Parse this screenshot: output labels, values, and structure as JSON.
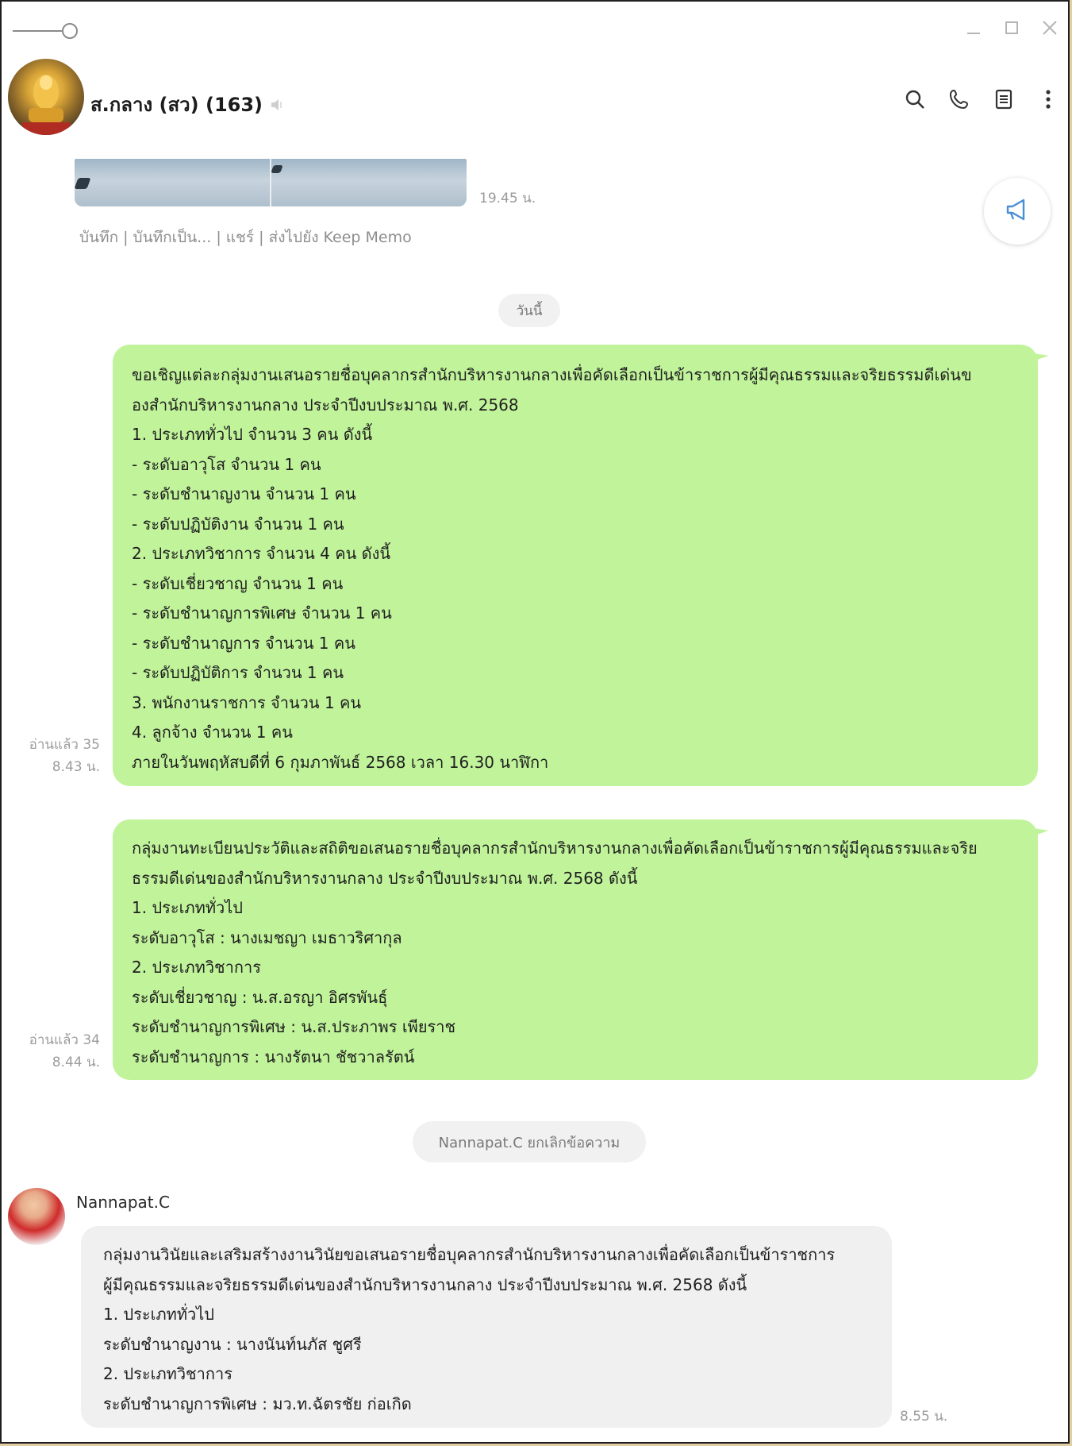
{
  "window": {
    "controls": {
      "minimize": "—",
      "maximize": "□",
      "close": "✕"
    }
  },
  "header": {
    "group_name": "ส.กลาง (สว) (163)",
    "icons": [
      "search-icon",
      "phone-icon",
      "notes-icon",
      "more-icon"
    ]
  },
  "previous_media": {
    "time": "19.45 น.",
    "actions": "บันทึก | บันทึกเป็น... | แชร์ | ส่งไปยัง Keep Memo"
  },
  "date_separator": "วันนี้",
  "messages": [
    {
      "read": "อ่านแล้ว 35",
      "time": "8.43 น.",
      "lines": [
        "ขอเชิญแต่ละกลุ่มงานเสนอรายชื่อบุคลากรสำนักบริหารงานกลางเพื่อคัดเลือกเป็นข้าราชการผู้มีคุณธรรมและจริยธรรมดีเด่นข",
        "องสำนักบริหารงานกลาง ประจำปีงบประมาณ พ.ศ. 2568",
        "1. ประเภททั่วไป จำนวน 3 คน ดังนี้",
        "- ระดับอาวุโส จำนวน 1 คน",
        "- ระดับชำนาญงาน จำนวน 1 คน",
        "- ระดับปฏิบัติงาน จำนวน 1 คน",
        "2. ประเภทวิชาการ จำนวน 4 คน ดังนี้",
        "- ระดับเชี่ยวชาญ จำนวน 1 คน",
        "- ระดับชำนาญการพิเศษ จำนวน 1 คน",
        "- ระดับชำนาญการ จำนวน 1 คน",
        "- ระดับปฏิบัติการ จำนวน 1 คน",
        "3. พนักงานราชการ จำนวน 1 คน",
        "4. ลูกจ้าง จำนวน 1 คน",
        "ภายในวันพฤหัสบดีที่ 6 กุมภาพันธ์ 2568 เวลา 16.30 นาฬิกา"
      ]
    },
    {
      "read": "อ่านแล้ว 34",
      "time": "8.44 น.",
      "lines": [
        "กลุ่มงานทะเบียนประวัติและสถิติขอเสนอรายชื่อบุคลากรสำนักบริหารงานกลางเพื่อคัดเลือกเป็นข้าราชการผู้มีคุณธรรมและจริย",
        "ธรรมดีเด่นของสำนักบริหารงานกลาง ประจำปีงบประมาณ พ.ศ. 2568 ดังนี้",
        "1. ประเภททั่วไป",
        "ระดับอาวุโส : นางเมชญา เมธาวริศากุล",
        "2. ประเภทวิชาการ",
        "ระดับเชี่ยวชาญ : น.ส.อรญา อิศรพันธุ์",
        "ระดับชำนาญการพิเศษ : น.ส.ประภาพร เพียราช",
        "ระดับชำนาญการ : นางรัตนา ชัชวาลรัตน์"
      ]
    }
  ],
  "system_notice": "Nannapat.C ยกเลิกข้อความ",
  "incoming": {
    "sender": "Nannapat.C",
    "time": "8.55 น.",
    "lines": [
      "กลุ่มงานวินัยและเสริมสร้างงานวินัยขอเสนอรายชื่อบุคลากรสำนักบริหารงานกลางเพื่อคัดเลือกเป็นข้าราชการ",
      "ผู้มีคุณธรรมและจริยธรรมดีเด่นของสำนักบริหารงานกลาง ประจำปีงบประมาณ พ.ศ. 2568 ดังนี้",
      "1. ประเภททั่วไป",
      "ระดับชำนาญงาน : นางนันท์นภัส ชูศรี",
      "2. ประเภทวิชาการ",
      "ระดับชำนาญการพิเศษ : มว.ท.ฉัตรชัย ก่อเกิด"
    ]
  },
  "colors": {
    "outgoing_bubble": "#c0f39a",
    "incoming_bubble": "#f0f0f0",
    "meta_text": "#9c9c9c"
  }
}
